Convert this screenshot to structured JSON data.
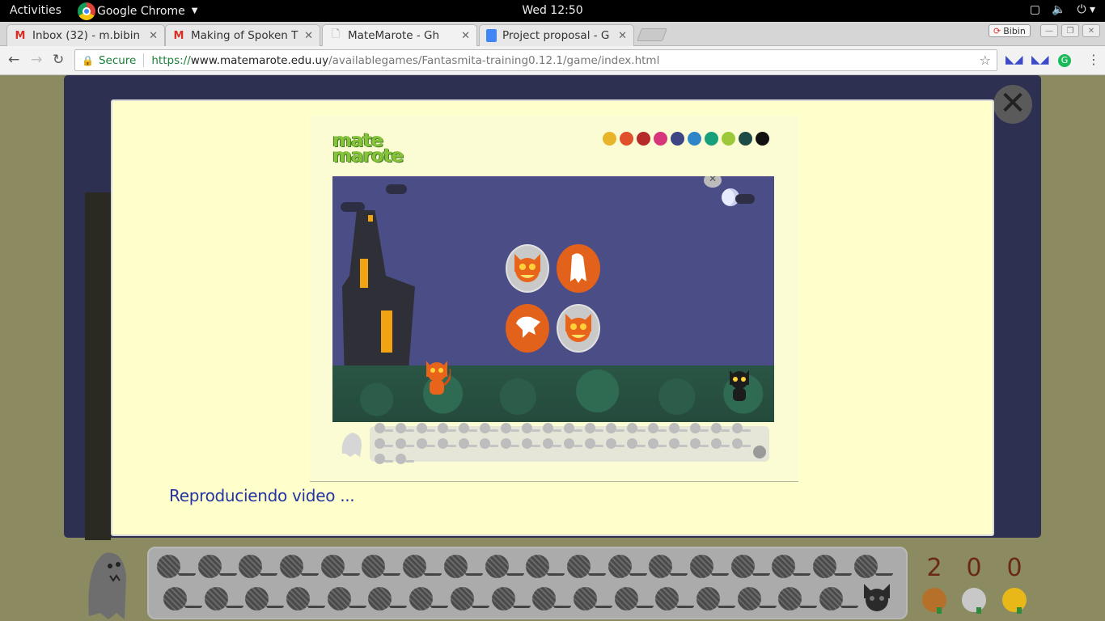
{
  "topbar": {
    "activities": "Activities",
    "app_name": "Google Chrome",
    "clock": "Wed 12:50"
  },
  "tabs": [
    {
      "label": "Inbox (32) - m.bibin",
      "icon": "gmail-icon"
    },
    {
      "label": "Making of Spoken T",
      "icon": "gmail-icon"
    },
    {
      "label": "MateMarote - Gh",
      "icon": "document-icon",
      "active": true
    },
    {
      "label": "Project proposal - G",
      "icon": "google-docs-icon"
    }
  ],
  "profile_name": "Bibin",
  "address": {
    "secure_label": "Secure",
    "scheme": "https://",
    "host": "www.matemarote.edu.uy",
    "path": "/availablegames/Fantasmita-training0.12.1/game/index.html"
  },
  "game": {
    "logo_line1": "mate",
    "logo_line2": "marote",
    "swatch_colors": [
      "#e8b52a",
      "#e0502a",
      "#b62a2a",
      "#d8367a",
      "#3d4585",
      "#2e86c8",
      "#18a07a",
      "#9cc83a",
      "#1e4a48",
      "#111111"
    ],
    "loading_text": "Reproduciendo video ..."
  },
  "scores": [
    {
      "value": "2",
      "medal": "bronze",
      "color": "#b5702a"
    },
    {
      "value": "0",
      "medal": "silver",
      "color": "#c8c8c8"
    },
    {
      "value": "0",
      "medal": "gold",
      "color": "#e8b818"
    }
  ],
  "colors": {
    "panel": "#2d3050",
    "modal": "#ffffcc",
    "scene_sky": "#4b4d86",
    "loading_text": "#2434a2"
  }
}
